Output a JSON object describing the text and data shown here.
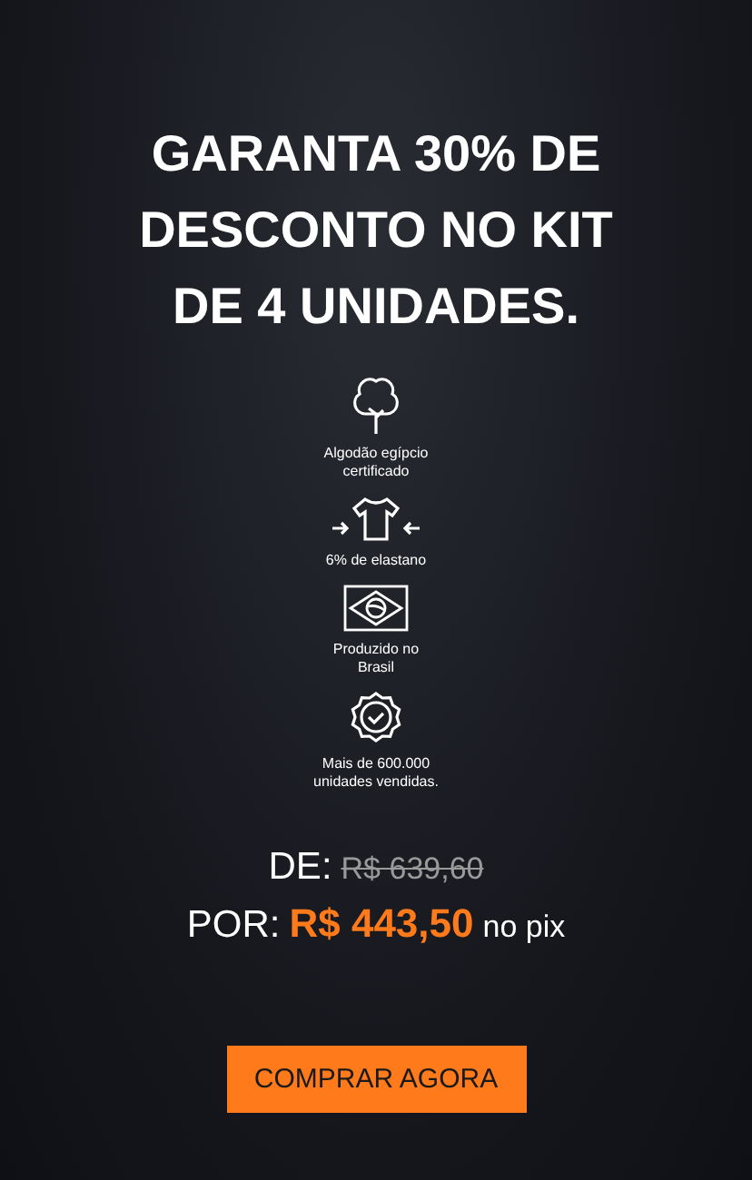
{
  "headline": [
    "GARANTA 30% DE",
    "DESCONTO NO KIT",
    "DE 4 UNIDADES."
  ],
  "features": [
    {
      "kind": "tree",
      "lines": [
        "Algodão egípcio",
        "certificado"
      ]
    },
    {
      "kind": "shirt",
      "lines": [
        "6% de elastano"
      ]
    },
    {
      "kind": "flag",
      "lines": [
        "Produzido no",
        "Brasil"
      ]
    },
    {
      "kind": "seal",
      "lines": [
        "Mais de 600.000",
        "unidades vendidas."
      ]
    }
  ],
  "price": {
    "old_label": "DE:",
    "old_value": "R$ 639,60",
    "new_label": "POR:",
    "new_value": "R$ 443,50",
    "suffix": "no pix"
  },
  "button": "COMPRAR AGORA"
}
